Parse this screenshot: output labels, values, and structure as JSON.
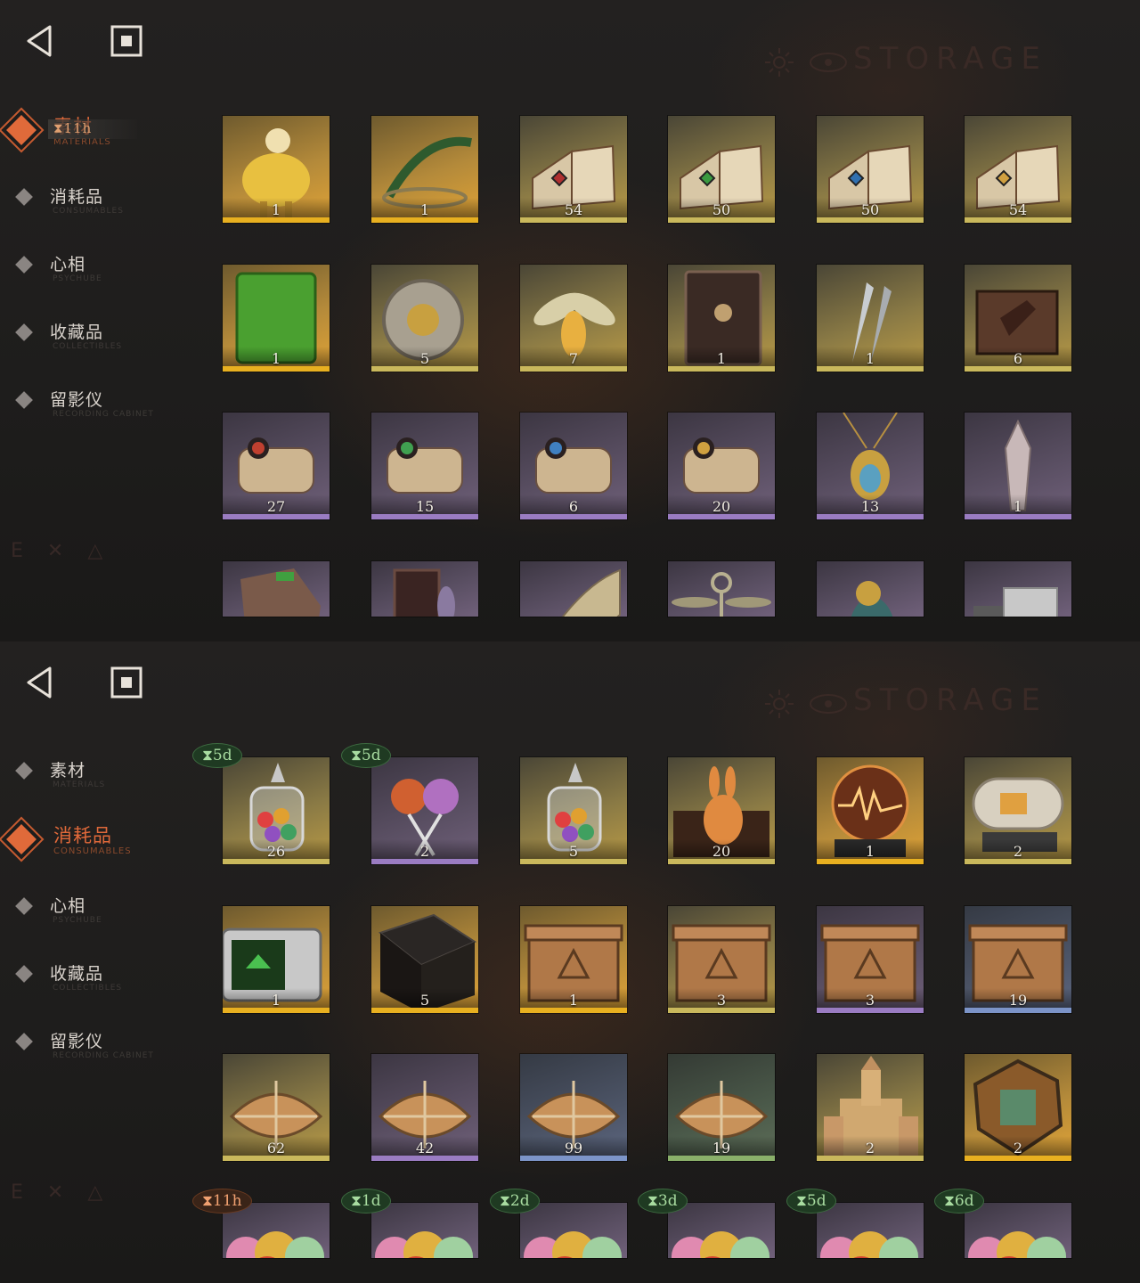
{
  "panels": [
    {
      "storage_title": "STORAGE",
      "nav": [
        {
          "label": "素材",
          "sub": "MATERIALS",
          "active": true
        },
        {
          "label": "消耗品",
          "sub": "CONSUMABLES",
          "active": false
        },
        {
          "label": "心相",
          "sub": "PSYCHUBE",
          "active": false
        },
        {
          "label": "收藏品",
          "sub": "COLLECTIBLES",
          "active": false
        },
        {
          "label": "留影仪",
          "sub": "RECORDING CABINET",
          "active": false
        }
      ],
      "nav_timer": "11h",
      "items": [
        {
          "count": "1",
          "rarity": "gold",
          "icon": "sheep-statue-icon"
        },
        {
          "count": "1",
          "rarity": "gold",
          "icon": "laurel-wreath-icon"
        },
        {
          "count": "54",
          "rarity": "olive",
          "icon": "red-rune-book-icon"
        },
        {
          "count": "50",
          "rarity": "olive",
          "icon": "green-rune-book-icon"
        },
        {
          "count": "50",
          "rarity": "olive",
          "icon": "blue-rune-book-icon"
        },
        {
          "count": "54",
          "rarity": "olive",
          "icon": "gold-rune-book-icon"
        },
        {
          "count": "1",
          "rarity": "gold",
          "icon": "green-tablet-icon"
        },
        {
          "count": "5",
          "rarity": "olive",
          "icon": "pocket-watch-icon"
        },
        {
          "count": "7",
          "rarity": "olive",
          "icon": "firefly-icon"
        },
        {
          "count": "1",
          "rarity": "olive",
          "icon": "dark-tome-icon"
        },
        {
          "count": "1",
          "rarity": "olive",
          "icon": "bullets-icon"
        },
        {
          "count": "6",
          "rarity": "olive",
          "icon": "hand-box-icon"
        },
        {
          "count": "27",
          "rarity": "purple",
          "icon": "red-scroll-icon"
        },
        {
          "count": "15",
          "rarity": "purple",
          "icon": "green-scroll-icon"
        },
        {
          "count": "6",
          "rarity": "purple",
          "icon": "blue-scroll-icon"
        },
        {
          "count": "20",
          "rarity": "purple",
          "icon": "gold-scroll-icon"
        },
        {
          "count": "13",
          "rarity": "purple",
          "icon": "beetle-amulet-icon"
        },
        {
          "count": "1",
          "rarity": "purple",
          "icon": "crystal-pendant-icon"
        },
        {
          "count": "",
          "rarity": "purple",
          "icon": "rock-fossil-icon"
        },
        {
          "count": "",
          "rarity": "purple",
          "icon": "window-frame-icon"
        },
        {
          "count": "",
          "rarity": "purple",
          "icon": "mechanical-wing-icon"
        },
        {
          "count": "",
          "rarity": "purple",
          "icon": "winged-key-icon"
        },
        {
          "count": "",
          "rarity": "purple",
          "icon": "bird-figurine-icon"
        },
        {
          "count": "",
          "rarity": "purple",
          "icon": "silver-bars-icon"
        }
      ]
    },
    {
      "storage_title": "STORAGE",
      "nav": [
        {
          "label": "素材",
          "sub": "MATERIALS",
          "active": false
        },
        {
          "label": "消耗品",
          "sub": "CONSUMABLES",
          "active": true
        },
        {
          "label": "心相",
          "sub": "PSYCHUBE",
          "active": false
        },
        {
          "label": "收藏品",
          "sub": "COLLECTIBLES",
          "active": false
        },
        {
          "label": "留影仪",
          "sub": "RECORDING CABINET",
          "active": false
        }
      ],
      "nav_timer": "",
      "items": [
        {
          "count": "26",
          "rarity": "olive",
          "icon": "candy-jar-icon",
          "timer": "5d",
          "timer_color": "green"
        },
        {
          "count": "2",
          "rarity": "purple",
          "icon": "lollipops-icon",
          "timer": "5d",
          "timer_color": "green"
        },
        {
          "count": "5",
          "rarity": "olive",
          "icon": "candy-jar-icon"
        },
        {
          "count": "20",
          "rarity": "olive",
          "icon": "rabbit-box-icon"
        },
        {
          "count": "1",
          "rarity": "gold",
          "icon": "radio-orb-icon"
        },
        {
          "count": "2",
          "rarity": "olive",
          "icon": "capsule-machine-icon"
        },
        {
          "count": "1",
          "rarity": "gold",
          "icon": "old-tv-icon"
        },
        {
          "count": "5",
          "rarity": "gold",
          "icon": "rune-table-icon"
        },
        {
          "count": "1",
          "rarity": "gold",
          "icon": "crate-icon"
        },
        {
          "count": "3",
          "rarity": "olive",
          "icon": "crate-icon"
        },
        {
          "count": "3",
          "rarity": "purple",
          "icon": "crate-icon"
        },
        {
          "count": "19",
          "rarity": "blue",
          "icon": "crate-icon"
        },
        {
          "count": "62",
          "rarity": "olive",
          "icon": "parcel-icon"
        },
        {
          "count": "42",
          "rarity": "purple",
          "icon": "parcel-icon"
        },
        {
          "count": "99",
          "rarity": "blue",
          "icon": "parcel-icon"
        },
        {
          "count": "19",
          "rarity": "green",
          "icon": "parcel-icon"
        },
        {
          "count": "2",
          "rarity": "olive",
          "icon": "sand-castle-icon"
        },
        {
          "count": "2",
          "rarity": "gold",
          "icon": "mosaic-emblem-icon"
        },
        {
          "count": "",
          "rarity": "purple",
          "icon": "candies-icon",
          "timer": "11h",
          "timer_color": "orange"
        },
        {
          "count": "",
          "rarity": "purple",
          "icon": "candies-icon",
          "timer": "1d",
          "timer_color": "green"
        },
        {
          "count": "",
          "rarity": "purple",
          "icon": "candies-icon",
          "timer": "2d",
          "timer_color": "green"
        },
        {
          "count": "",
          "rarity": "purple",
          "icon": "candies-icon",
          "timer": "3d",
          "timer_color": "green"
        },
        {
          "count": "",
          "rarity": "purple",
          "icon": "candies-icon",
          "timer": "5d",
          "timer_color": "green"
        },
        {
          "count": "",
          "rarity": "purple",
          "icon": "candies-icon",
          "timer": "6d",
          "timer_color": "green"
        }
      ]
    }
  ],
  "timer_glyph": "⧗",
  "colors": {
    "accent": "#e0693a",
    "gold_bar": "#e8b020",
    "olive_bar": "#c9b85c",
    "purple_bar": "#9a7cc2",
    "blue_bar": "#7c94c8",
    "green_bar": "#8ab06a"
  }
}
